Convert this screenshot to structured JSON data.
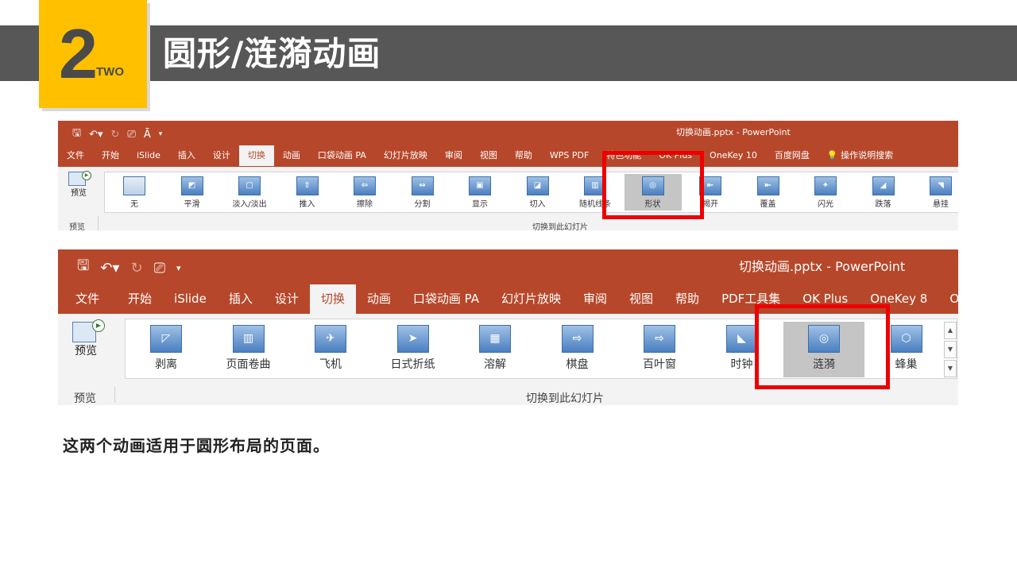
{
  "slide": {
    "number": "2",
    "number_word": "TWO",
    "title": "圆形/涟漪动画",
    "caption": "这两个动画适用于圆形布局的页面。",
    "accent_color": "#ffc000",
    "header_color": "#575757",
    "highlight_color": "#ee0000"
  },
  "ribbon_top": {
    "doc_title": "切换动画.pptx  -  PowerPoint",
    "qat": [
      "save-icon",
      "undo-icon",
      "redo-icon",
      "slideshow-icon",
      "text-icon",
      "customize-icon"
    ],
    "tabs": [
      "文件",
      "开始",
      "iSlide",
      "插入",
      "设计",
      "切换",
      "动画",
      "口袋动画 PA",
      "幻灯片放映",
      "审阅",
      "视图",
      "帮助",
      "WPS PDF",
      "特色功能",
      "OK Plus",
      "OneKey 10",
      "百度网盘",
      "操作说明搜索"
    ],
    "active_tab": "切换",
    "preview_label": "预览",
    "preview_group_label": "预览",
    "group_label": "切换到此幻灯片",
    "transitions": [
      "无",
      "平滑",
      "淡入/淡出",
      "推入",
      "擦除",
      "分割",
      "显示",
      "切入",
      "随机线条",
      "形状",
      "揭开",
      "覆盖",
      "闪光",
      "跌落",
      "悬挂"
    ],
    "selected": "形状",
    "accent_color": "#b7472a"
  },
  "ribbon_bottom": {
    "doc_title": "切换动画.pptx  -  PowerPoint",
    "qat": [
      "save-icon",
      "undo-icon",
      "redo-icon",
      "slideshow-icon",
      "customize-icon"
    ],
    "tabs": [
      "文件",
      "开始",
      "iSlide",
      "插入",
      "设计",
      "切换",
      "动画",
      "口袋动画 PA",
      "幻灯片放映",
      "审阅",
      "视图",
      "帮助",
      "PDF工具集",
      "OK Plus",
      "OneKey 8",
      "One"
    ],
    "active_tab": "切换",
    "preview_label": "预览",
    "preview_group_label": "预览",
    "group_label": "切换到此幻灯片",
    "transitions": [
      "剥离",
      "页面卷曲",
      "飞机",
      "日式折纸",
      "溶解",
      "棋盘",
      "百叶窗",
      "时钟",
      "涟漪",
      "蜂巢"
    ],
    "selected": "涟漪",
    "accent_color": "#b7472a"
  }
}
